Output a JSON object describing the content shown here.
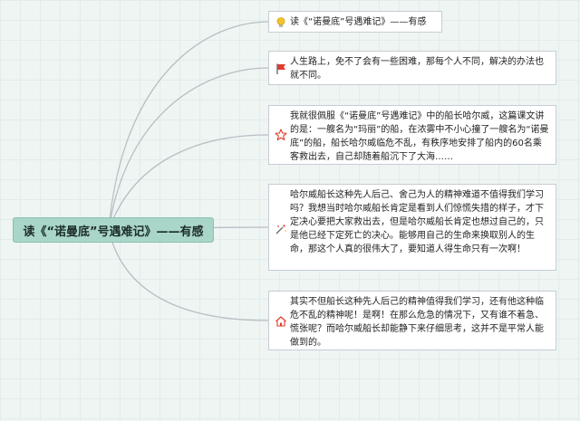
{
  "root": {
    "title": "读《“诺曼底”号遇难记》——有感"
  },
  "branches": [
    {
      "icon": "lightbulb-icon",
      "text": "读《“诺曼底”号遇难记》——有感"
    },
    {
      "icon": "red-flag-icon",
      "text": "人生路上，免不了会有一些困难，那每个人不同，解决的办法也就不同。"
    },
    {
      "icon": "star-outline-icon",
      "text": "我就很佩服《“诺曼底”号遇难记》中的船长哈尔威，这篇课文讲的是：一艘名为“玛丽”的船，在浓雾中不小心撞了一艘名为“诺曼底”的船，船长哈尔威临危不乱，有秩序地安排了船内的60名乘客救出去，自己却随着船沉下了大海……"
    },
    {
      "icon": "magic-wand-icon",
      "text": "哈尔威船长这种先人后己、舍己为人的精神难道不值得我们学习吗？我想当时哈尔威船长肯定是看到人们惊慌失措的样子，才下定决心要把大家救出去，但是哈尔威船长肯定也想过自己的，只是他已经下定死亡的决心。能够用自己的生命来换取别人的生命，那这个人真的很伟大了，要知道人得生命只有一次啊！"
    },
    {
      "icon": "home-icon",
      "text": "其实不但船长这种先人后己的精神值得我们学习，还有他这种临危不乱的精神呢！是啊！在那么危急的情况下，又有谁不着急、慌张呢？而哈尔威船长却能静下来仔细思考，这并不是平常人能做到的。"
    }
  ],
  "colors": {
    "root_fill": "#a9d6c9",
    "connector": "#b9bec4",
    "flag": "#e23b2e",
    "star": "#e23b2e",
    "bulb": "#f2c12e"
  }
}
